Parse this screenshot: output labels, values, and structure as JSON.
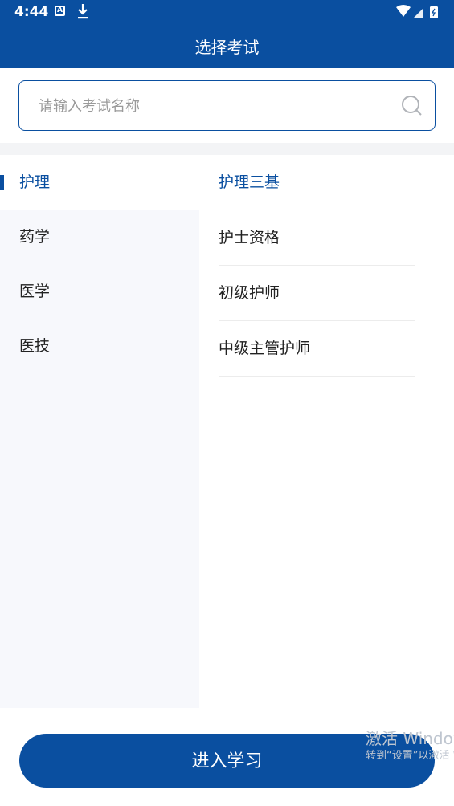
{
  "status_bar": {
    "time": "4:44",
    "notification_a": "A"
  },
  "header": {
    "title": "选择考试"
  },
  "search": {
    "placeholder": "请输入考试名称",
    "value": ""
  },
  "categories": [
    {
      "label": "护理",
      "active": true
    },
    {
      "label": "药学",
      "active": false
    },
    {
      "label": "医学",
      "active": false
    },
    {
      "label": "医技",
      "active": false
    }
  ],
  "sub_items": [
    {
      "label": "护理三基",
      "active": true
    },
    {
      "label": "护士资格",
      "active": false
    },
    {
      "label": "初级护师",
      "active": false
    },
    {
      "label": "中级主管护师",
      "active": false
    }
  ],
  "footer": {
    "enter_label": "进入学习"
  },
  "watermark": {
    "line1": "激活 Windows",
    "line2": "转到“设置”以激活 Windows。"
  },
  "colors": {
    "brand": "#0a4fa0",
    "sidebar_bg": "#f7f8fc",
    "divider": "#ececec"
  }
}
